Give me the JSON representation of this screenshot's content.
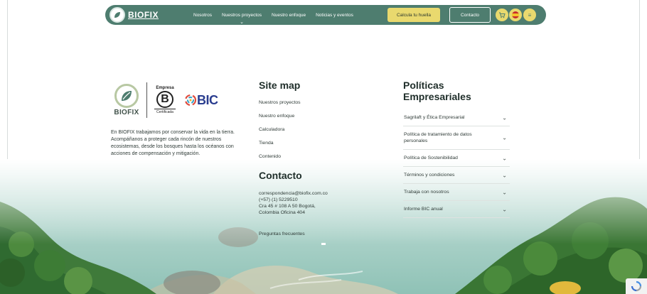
{
  "navbar": {
    "logo_text": "BIOFIX",
    "items": [
      {
        "label": "Nosotros",
        "has_dropdown": false
      },
      {
        "label": "Nuestros proyectos",
        "has_dropdown": true
      },
      {
        "label": "Nuestro enfoque",
        "has_dropdown": false
      },
      {
        "label": "Noticias y eventos",
        "has_dropdown": false
      }
    ],
    "cta_label": "Calcula tu huella",
    "contact_label": "Contacto",
    "icons": [
      "cart-icon",
      "spain-flag-icon",
      "menu-icon"
    ]
  },
  "brand": {
    "logo_word": "BIOFIX",
    "bcorp_top": "Empresa",
    "bcorp_letter": "B",
    "bcorp_bottom": "Certificada",
    "bic_word": "BIC",
    "description": "En BIOFIX trabajamos por conservar la vida en la tierra. Acompáñanos a proteger cada rincón de nuestros ecosistemas, desde los bosques hasta los océanos con acciones de compensación y mitigación."
  },
  "sitemap": {
    "title": "Site map",
    "links": [
      "Nuestros proyectos",
      "Nuestro enfoque",
      "Calculadora",
      "Tienda",
      "Contenido"
    ]
  },
  "contact": {
    "title": "Contacto",
    "email": "correspondencia@biofix.com.co",
    "phone": "(+57) (1) 5229510",
    "address_line1": "Cra 45 # 108 A 50 Bogotá,",
    "address_line2": "Colombia Oficina 404",
    "faq_label": "Preguntas frecuentes"
  },
  "policies": {
    "title_line1": "Políticas",
    "title_line2": "Empresariales",
    "items": [
      "Sagrilaft y Ética Empresarial",
      "Política de tratamiento de datos personales",
      "Política de Sostenibilidad",
      "Términos y condiciones",
      "Trabaja con nosotros",
      "Informe BIC anual"
    ]
  },
  "colors": {
    "navbar": "#4e7d6f",
    "accent_yellow": "#e9d96e",
    "text_dark": "#1f2e2a",
    "bic_blue": "#2a3d8f"
  }
}
